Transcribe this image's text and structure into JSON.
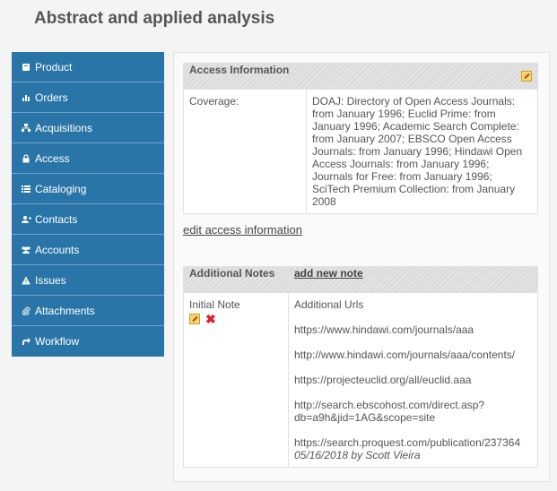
{
  "page": {
    "title": "Abstract and applied analysis"
  },
  "sidebar": {
    "items": [
      {
        "label": "Product",
        "icon": "book-icon"
      },
      {
        "label": "Orders",
        "icon": "bar-chart-icon"
      },
      {
        "label": "Acquisitions",
        "icon": "sitemap-icon"
      },
      {
        "label": "Access",
        "icon": "lock-icon"
      },
      {
        "label": "Cataloging",
        "icon": "list-icon"
      },
      {
        "label": "Contacts",
        "icon": "user-plus-icon"
      },
      {
        "label": "Accounts",
        "icon": "users-icon"
      },
      {
        "label": "Issues",
        "icon": "warning-icon"
      },
      {
        "label": "Attachments",
        "icon": "paperclip-icon"
      },
      {
        "label": "Workflow",
        "icon": "share-icon"
      }
    ]
  },
  "access": {
    "header": "Access Information",
    "coverage_label": "Coverage:",
    "coverage_value": "DOAJ: Directory of Open Access Journals: from January 1996; Euclid Prime: from January 1996; Academic Search Complete: from January 2007; EBSCO Open Access Journals: from January 1996; Hindawi Open Access Journals: from January 1996; Journals for Free: from January 1996; SciTech Premium Collection: from January 2008",
    "edit_link": "edit access information"
  },
  "notes": {
    "header": "Additional Notes",
    "add_link": "add new note",
    "rows": [
      {
        "title": "Initial Note",
        "heading": "Additional Urls",
        "urls": [
          "https://www.hindawi.com/journals/aaa",
          "http://www.hindawi.com/journals/aaa/contents/",
          "https://projecteuclid.org/all/euclid.aaa",
          "http://search.ebscohost.com/direct.asp?db=a9h&jid=1AG&scope=site",
          "https://search.proquest.com/publication/237364"
        ],
        "meta": "05/16/2018 by Scott Vieira"
      }
    ]
  }
}
